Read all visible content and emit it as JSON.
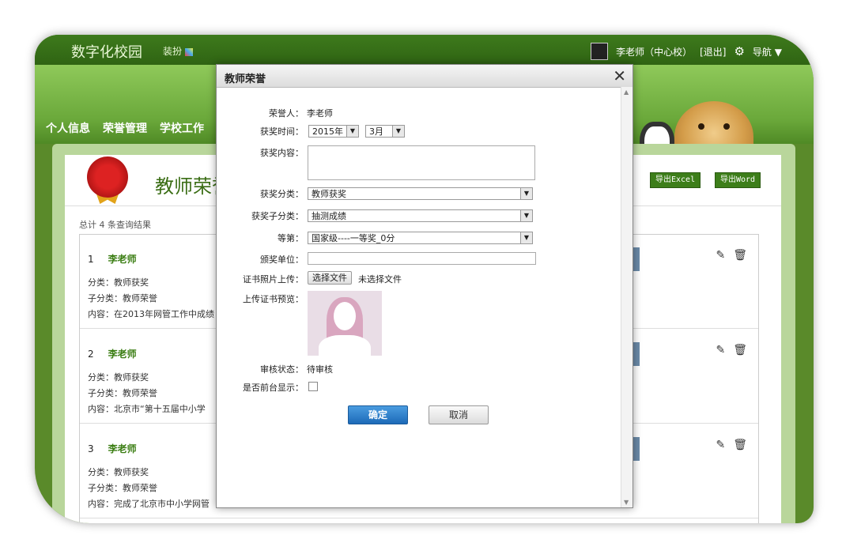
{
  "header": {
    "brand": "数字化校园",
    "skin_label": "装扮",
    "user_name": "李老师（中心校）",
    "logout": "[退出]",
    "nav_label": "导航",
    "nav_arrow": "▼"
  },
  "nav": [
    "个人信息",
    "荣誉管理",
    "学校工作"
  ],
  "page": {
    "title": "教师荣誉",
    "export_excel": "导出Excel",
    "export_word": "导出Word",
    "total": "总计 4 条查询结果"
  },
  "records": [
    {
      "index": "1",
      "name": "李老师",
      "category": "分类：教师获奖",
      "subcategory": "子分类：教师荣誉",
      "content": "内容：在2013年网管工作中成绩"
    },
    {
      "index": "2",
      "name": "李老师",
      "category": "分类：教师获奖",
      "subcategory": "子分类：教师荣誉",
      "content": "内容：北京市“第十五届中小学"
    },
    {
      "index": "3",
      "name": "李老师",
      "category": "分类：教师获奖",
      "subcategory": "子分类：教师荣誉",
      "content": "内容：完成了北京市中小学网管"
    }
  ],
  "icons": {
    "edit": "pencil-icon",
    "delete": "trash-icon",
    "close": "close-icon",
    "settings": "gear-icon"
  },
  "dialog": {
    "title": "教师荣誉",
    "close": "✕",
    "labels": {
      "honoree": "荣誉人：",
      "award_time": "获奖时间：",
      "award_content": "获奖内容：",
      "award_category": "获奖分类：",
      "award_subcategory": "获奖子分类：",
      "grade": "等第：",
      "issuer": "颁奖单位：",
      "upload": "证书照片上传：",
      "preview": "上传证书预览：",
      "review_status": "审核状态：",
      "front_display": "是否前台显示："
    },
    "values": {
      "honoree": "李老师",
      "year": "2015年",
      "month": "3月",
      "award_content": "",
      "award_category": "教师获奖",
      "award_subcategory": "抽测成绩",
      "grade": "国家级----一等奖_0分",
      "issuer": "",
      "choose_file": "选择文件",
      "no_file": "未选择文件",
      "review_status": "待审核",
      "front_display_checked": false
    },
    "buttons": {
      "ok": "确定",
      "cancel": "取消"
    }
  },
  "colors": {
    "brand_green": "#3e7a1c",
    "primary_blue": "#1d6ab8",
    "name_green": "#3a7d12"
  }
}
